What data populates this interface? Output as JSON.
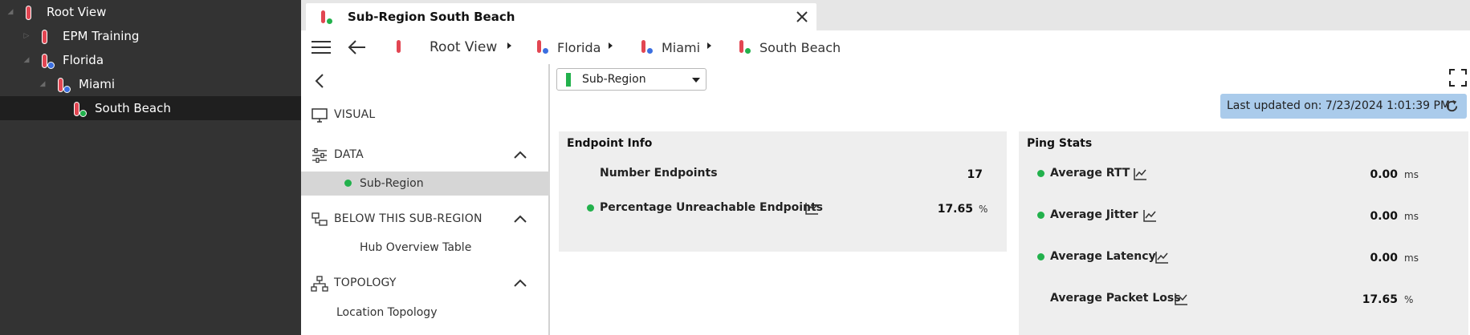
{
  "tree": {
    "items": [
      {
        "label": "Root View",
        "dot": ""
      },
      {
        "label": "EPM Training",
        "dot": ""
      },
      {
        "label": "Florida",
        "dot": "blue"
      },
      {
        "label": "Miami",
        "dot": "blue"
      },
      {
        "label": "South Beach",
        "dot": "green"
      }
    ]
  },
  "tab": {
    "title": "Sub-Region South Beach"
  },
  "breadcrumb": [
    {
      "label": "Root View"
    },
    {
      "label": "Florida"
    },
    {
      "label": "Miami"
    },
    {
      "label": "South Beach"
    }
  ],
  "nav": {
    "sections": {
      "visual": "VISUAL",
      "data": "DATA",
      "below": "BELOW THIS SUB-REGION",
      "topology": "TOPOLOGY"
    },
    "items": {
      "sub_region": "Sub-Region",
      "hub_table": "Hub Overview Table",
      "location_topology": "Location Topology"
    }
  },
  "main": {
    "view_select": "Sub-Region",
    "last_updated": "Last updated on: 7/23/2024 1:01:39 PM"
  },
  "endpoint_info": {
    "title": "Endpoint Info",
    "number_endpoints": {
      "label": "Number Endpoints",
      "value": "17"
    },
    "pct_unreachable": {
      "label": "Percentage Unreachable Endpoints",
      "value": "17.65",
      "unit": "%"
    }
  },
  "ping_stats": {
    "title": "Ping Stats",
    "avg_rtt": {
      "label": "Average RTT",
      "value": "0.00",
      "unit": "ms"
    },
    "avg_jitter": {
      "label": "Average Jitter",
      "value": "0.00",
      "unit": "ms"
    },
    "avg_latency": {
      "label": "Average Latency",
      "value": "0.00",
      "unit": "ms"
    },
    "avg_packet_loss": {
      "label": "Average Packet Loss",
      "value": "17.65",
      "unit": "%"
    }
  },
  "colors": {
    "tree_bg": "#333333",
    "node_red": "#e24652",
    "status_green": "#22b14c",
    "status_blue": "#3b6fe0",
    "updated_bg": "#aacbeb"
  }
}
